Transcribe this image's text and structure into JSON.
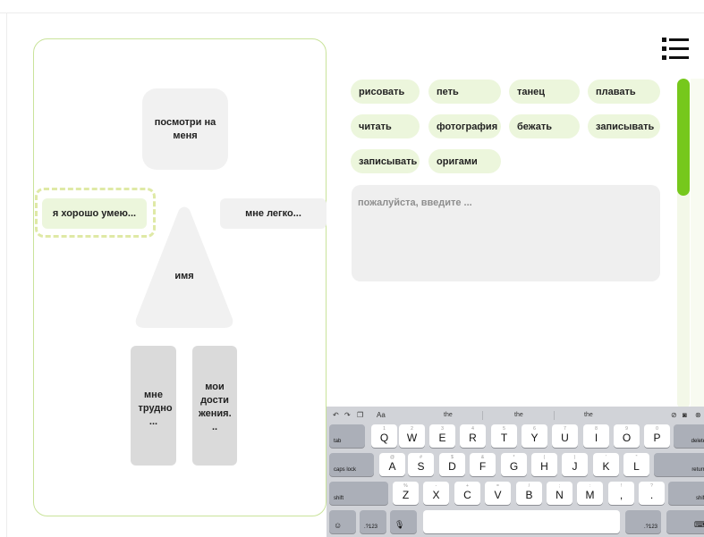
{
  "panel": {
    "look_at_me": "посмотри на меня",
    "i_am_good_at": "я хорошо умею...",
    "easy_for_me": "мне легко...",
    "name": "имя",
    "hard_for_me": "мне трудно ...",
    "my_achievements": "мои дости жения. .."
  },
  "chips": [
    "рисовать",
    "петь",
    "танец",
    "плавать",
    "читать",
    "фотография",
    "бежать",
    "записывать",
    "записывать",
    "оригами"
  ],
  "input": {
    "placeholder": "пожалуйста, введите ..."
  },
  "colors": {
    "accent": "#76c81c",
    "chip_bg": "#ecf6dc",
    "panel_border": "#c9e39a"
  },
  "keyboard": {
    "format_aa": "Aa",
    "suggestions": [
      "the",
      "the",
      "the"
    ],
    "row1": [
      "Q",
      "W",
      "E",
      "R",
      "T",
      "Y",
      "U",
      "I",
      "O",
      "P"
    ],
    "row1_hints": [
      "1",
      "2",
      "3",
      "4",
      "5",
      "6",
      "7",
      "8",
      "9",
      "0"
    ],
    "row2": [
      "A",
      "S",
      "D",
      "F",
      "G",
      "H",
      "J",
      "K",
      "L"
    ],
    "row2_hints": [
      "@",
      "#",
      "$",
      "&",
      "*",
      "(",
      ")",
      "'",
      "\""
    ],
    "row3": [
      "Z",
      "X",
      "C",
      "V",
      "B",
      "N",
      "M",
      "!",
      ","
    ],
    "row3_hints": [
      "%",
      "-",
      "+",
      "=",
      "/",
      ";",
      ":",
      "!",
      ","
    ],
    "row3_extra": "?",
    "row3_extra_sub": ".",
    "tab": "tab",
    "delete": "delete",
    "caps_lock": "caps lock",
    "return": "return",
    "shift": "shift",
    "num": ".?123",
    "num_right": ".?123"
  }
}
